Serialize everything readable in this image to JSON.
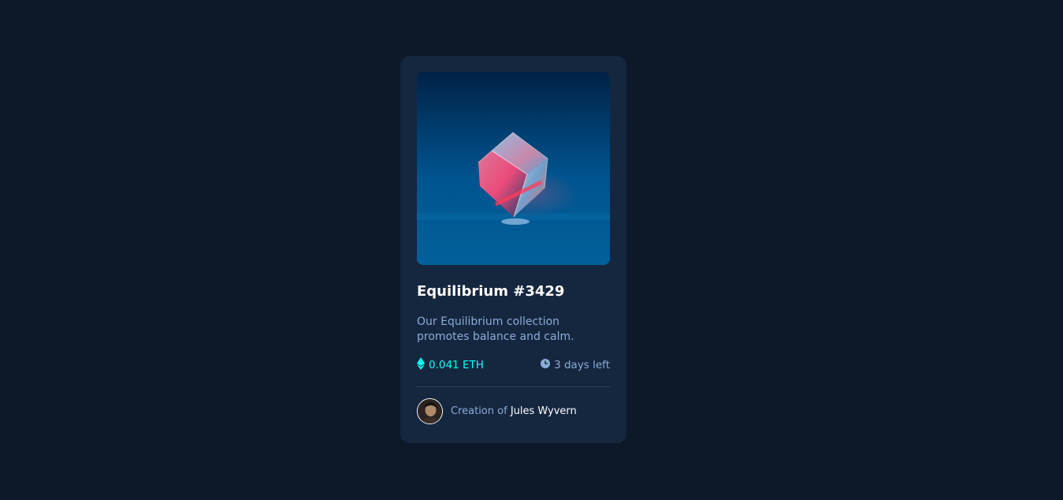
{
  "card": {
    "image_alt": "Equilibrium",
    "title": "Equilibrium #3429",
    "description": "Our Equilibrium collection promotes balance and calm.",
    "price": "0.041 ETH",
    "time_left": "3 days left",
    "creator_prefix": "Creation of",
    "creator_name": "Jules Wyvern"
  },
  "icons": {
    "price": "ethereum-icon",
    "time": "clock-icon"
  },
  "colors": {
    "background": "#0d1829",
    "card": "#15263f",
    "accent_cyan": "#00fff8",
    "soft_blue": "#8bacd9",
    "white": "#ffffff"
  }
}
